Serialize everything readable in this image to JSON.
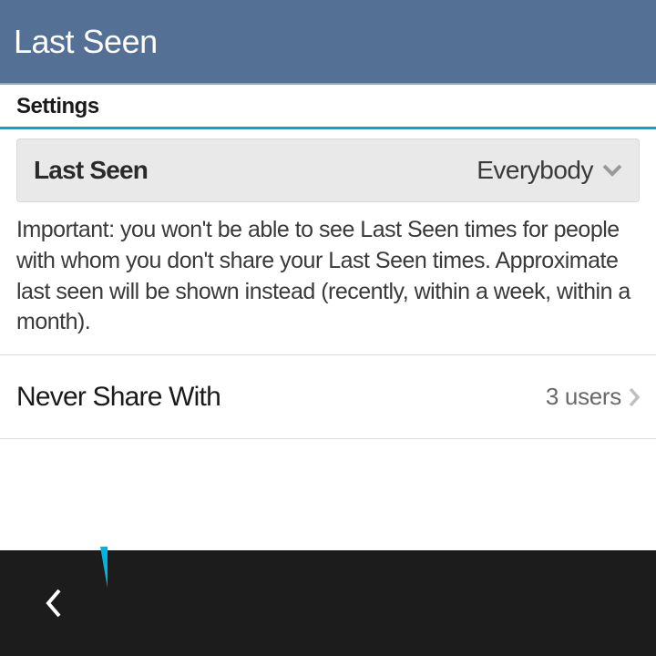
{
  "header": {
    "title": "Last Seen"
  },
  "section": {
    "label": "Settings"
  },
  "lastSeen": {
    "label": "Last Seen",
    "value": "Everybody"
  },
  "description": "Important: you won't be able to see Last Seen times for people with whom you don't share your Last Seen times. Approximate last seen will be shown instead (recently, within a week, within a month).",
  "neverShare": {
    "label": "Never Share With",
    "value": "3 users"
  }
}
